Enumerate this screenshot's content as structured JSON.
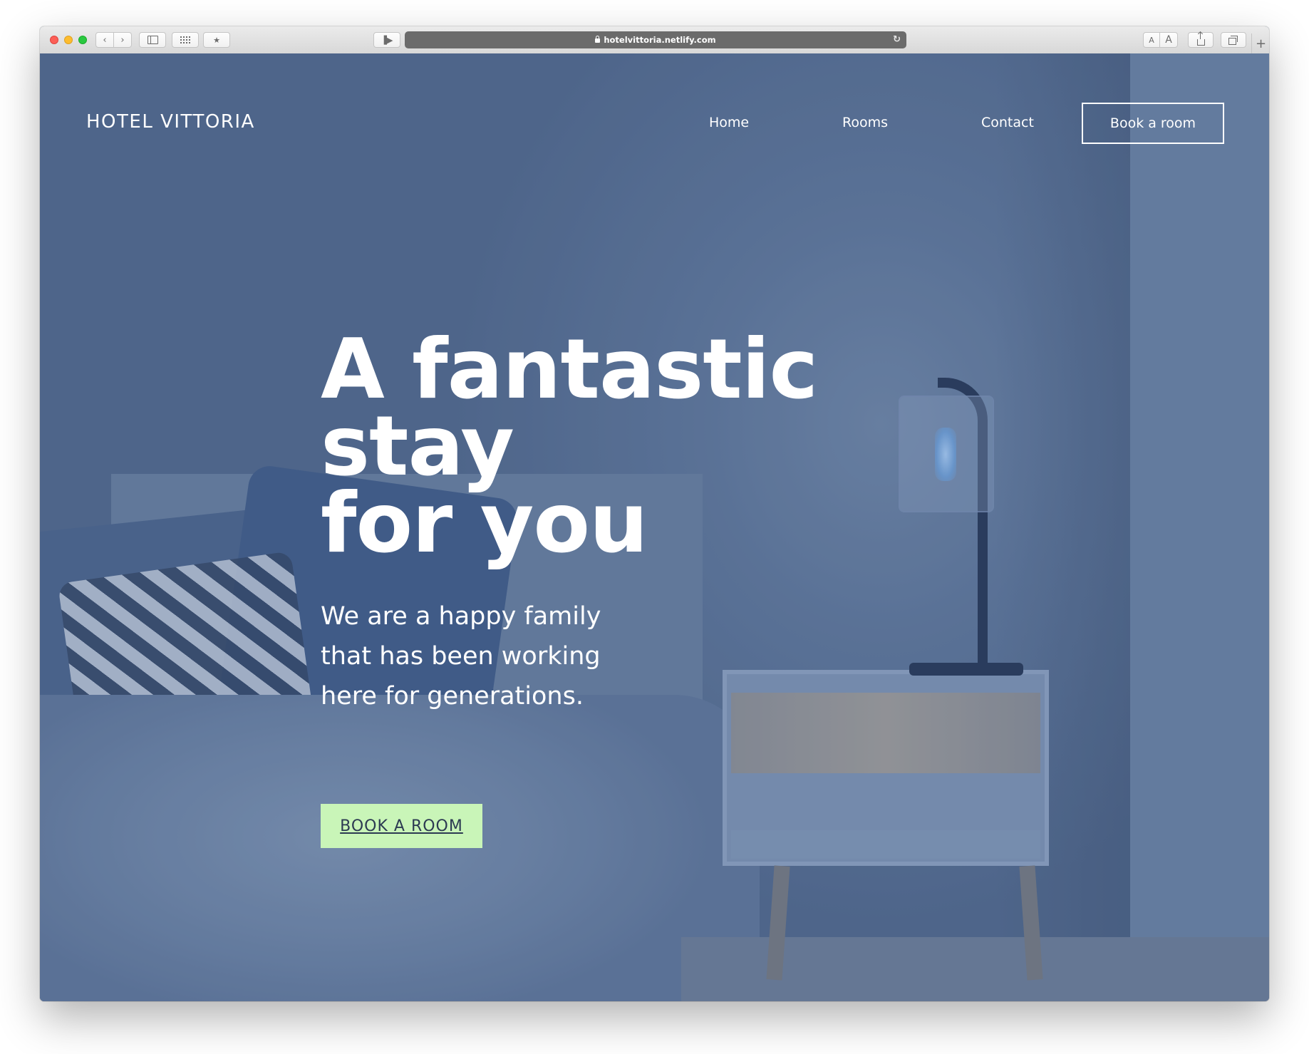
{
  "browser": {
    "url": "hotelvittoria.netlify.com",
    "text_small_label": "A",
    "text_large_label": "A",
    "new_tab_label": "+"
  },
  "site": {
    "logo": "HOTEL VITTORIA",
    "nav": {
      "home": "Home",
      "rooms": "Rooms",
      "contact": "Contact",
      "book": "Book a room"
    }
  },
  "hero": {
    "title_lines": [
      "A fantastic",
      "stay",
      "for you"
    ],
    "subtitle": "We are a happy family that has been working here for generations.",
    "cta": "BOOK A ROOM"
  },
  "colors": {
    "overlay": "#5a7196",
    "cta_background": "#c9f5b8",
    "cta_text": "#2c3a52"
  }
}
